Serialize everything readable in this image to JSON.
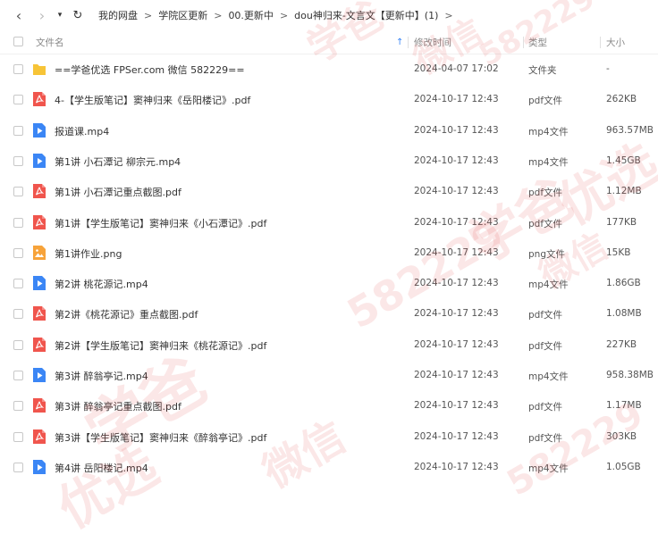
{
  "toolbar": {
    "back_glyph": "‹",
    "forward_glyph": "›",
    "dropdown_glyph": "▾",
    "refresh_glyph": "↻"
  },
  "breadcrumb": {
    "items": [
      "我的网盘",
      "学院区更新",
      "00.更新中",
      "dou神归来-文言文【更新中】(1)"
    ],
    "separator": ">"
  },
  "header": {
    "name": "文件名",
    "sort_glyph": "↑",
    "date": "修改时间",
    "type": "类型",
    "size": "大小"
  },
  "files": [
    {
      "icon": "folder",
      "name": "==学爸优选 FPSer.com 微信 582229==",
      "date": "2024-04-07 17:02",
      "type": "文件夹",
      "size": "-"
    },
    {
      "icon": "pdf",
      "name": "4-【学生版笔记】窦神归来《岳阳楼记》.pdf",
      "date": "2024-10-17 12:43",
      "type": "pdf文件",
      "size": "262KB"
    },
    {
      "icon": "video",
      "name": "报道课.mp4",
      "date": "2024-10-17 12:43",
      "type": "mp4文件",
      "size": "963.57MB"
    },
    {
      "icon": "video",
      "name": "第1讲 小石潭记 柳宗元.mp4",
      "date": "2024-10-17 12:43",
      "type": "mp4文件",
      "size": "1.45GB"
    },
    {
      "icon": "pdf",
      "name": "第1讲 小石潭记重点截图.pdf",
      "date": "2024-10-17 12:43",
      "type": "pdf文件",
      "size": "1.12MB"
    },
    {
      "icon": "pdf",
      "name": "第1讲【学生版笔记】窦神归来《小石潭记》.pdf",
      "date": "2024-10-17 12:43",
      "type": "pdf文件",
      "size": "177KB"
    },
    {
      "icon": "image",
      "name": "第1讲作业.png",
      "date": "2024-10-17 12:43",
      "type": "png文件",
      "size": "15KB"
    },
    {
      "icon": "video",
      "name": "第2讲 桃花源记.mp4",
      "date": "2024-10-17 12:43",
      "type": "mp4文件",
      "size": "1.86GB"
    },
    {
      "icon": "pdf",
      "name": "第2讲《桃花源记》重点截图.pdf",
      "date": "2024-10-17 12:43",
      "type": "pdf文件",
      "size": "1.08MB"
    },
    {
      "icon": "pdf",
      "name": "第2讲【学生版笔记】窦神归来《桃花源记》.pdf",
      "date": "2024-10-17 12:43",
      "type": "pdf文件",
      "size": "227KB"
    },
    {
      "icon": "video",
      "name": "第3讲 醉翁亭记.mp4",
      "date": "2024-10-17 12:43",
      "type": "mp4文件",
      "size": "958.38MB"
    },
    {
      "icon": "pdf",
      "name": "第3讲 醉翁亭记重点截图.pdf",
      "date": "2024-10-17 12:43",
      "type": "pdf文件",
      "size": "1.17MB"
    },
    {
      "icon": "pdf",
      "name": "第3讲【学生版笔记】窦神归来《醉翁亭记》.pdf",
      "date": "2024-10-17 12:43",
      "type": "pdf文件",
      "size": "303KB"
    },
    {
      "icon": "video",
      "name": "第4讲 岳阳楼记.mp4",
      "date": "2024-10-17 12:43",
      "type": "mp4文件",
      "size": "1.05GB"
    }
  ],
  "watermark": {
    "lines": [
      "学爸",
      "微信",
      "582229",
      "优选"
    ]
  },
  "colors": {
    "pdf": "#f0554d",
    "video": "#3b86f5",
    "folder": "#f7c437",
    "image": "#f7a33a",
    "watermark": "#e23c3c"
  }
}
